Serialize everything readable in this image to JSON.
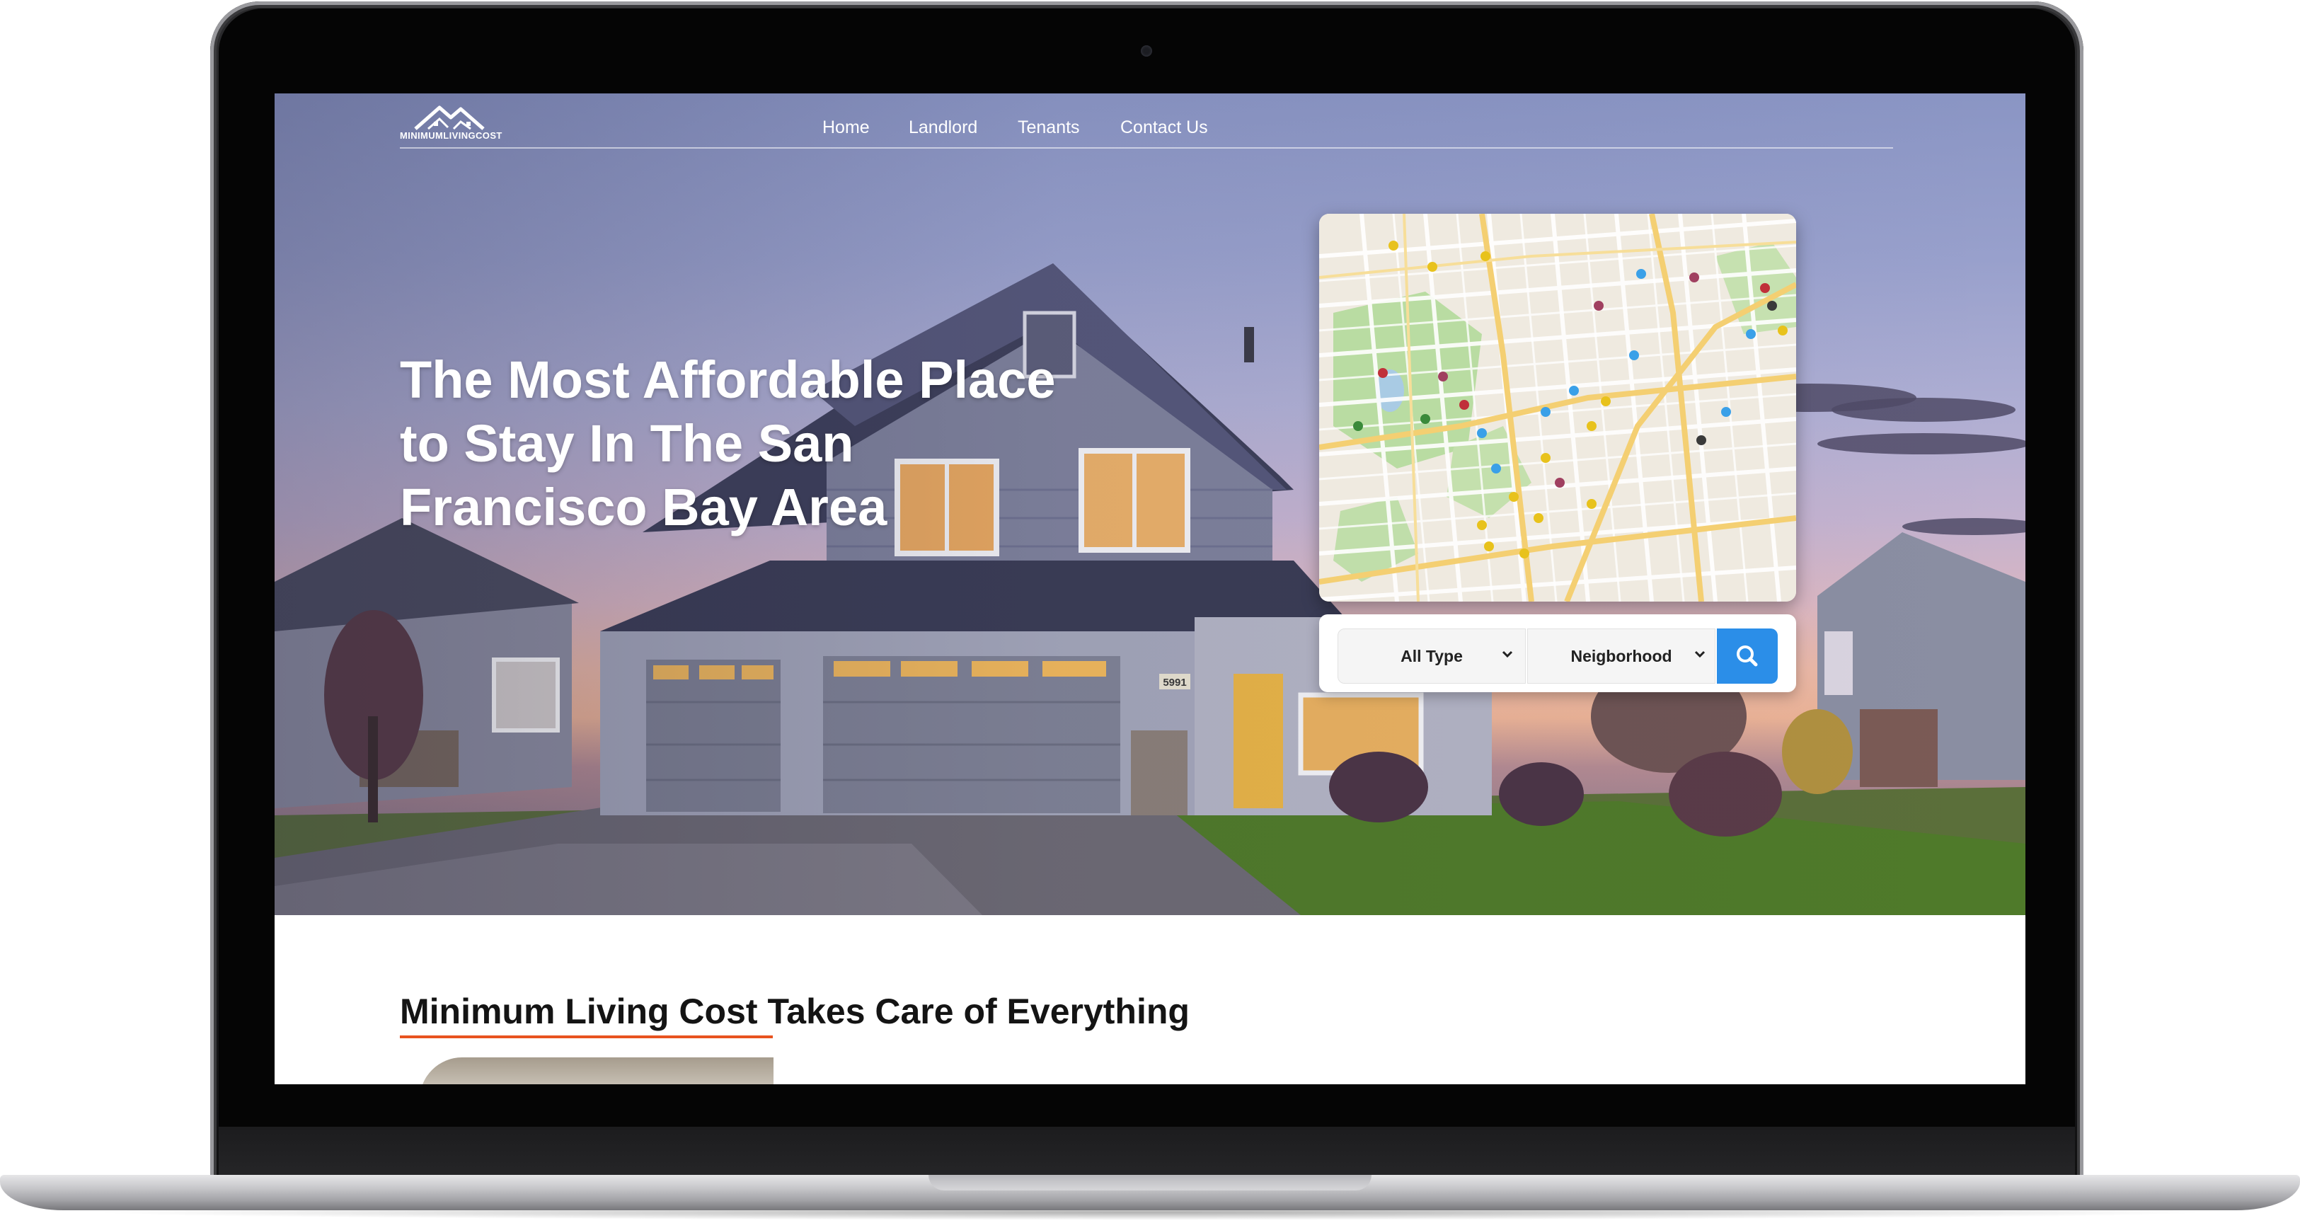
{
  "nav": {
    "logo_text": "MINIMUMLIVINGCOST",
    "links": [
      "Home",
      "Landlord",
      "Tenants",
      "Contact Us"
    ]
  },
  "hero": {
    "headline_lines": [
      "The Most Affordable Place",
      "to Stay In The San",
      "Francisco Bay Area"
    ],
    "house_number": "5991"
  },
  "search": {
    "type_select": "All Type",
    "neighborhood_select": "Neigborhood",
    "button_icon": "search-icon"
  },
  "section": {
    "title_highlight": "Minimum Living Cost",
    "title_rest": " Takes Care of Everything"
  },
  "colors": {
    "accent_blue": "#2b8ee8",
    "accent_orange": "#e8531f",
    "heading_text": "#141414",
    "nav_text": "#ffffff"
  }
}
